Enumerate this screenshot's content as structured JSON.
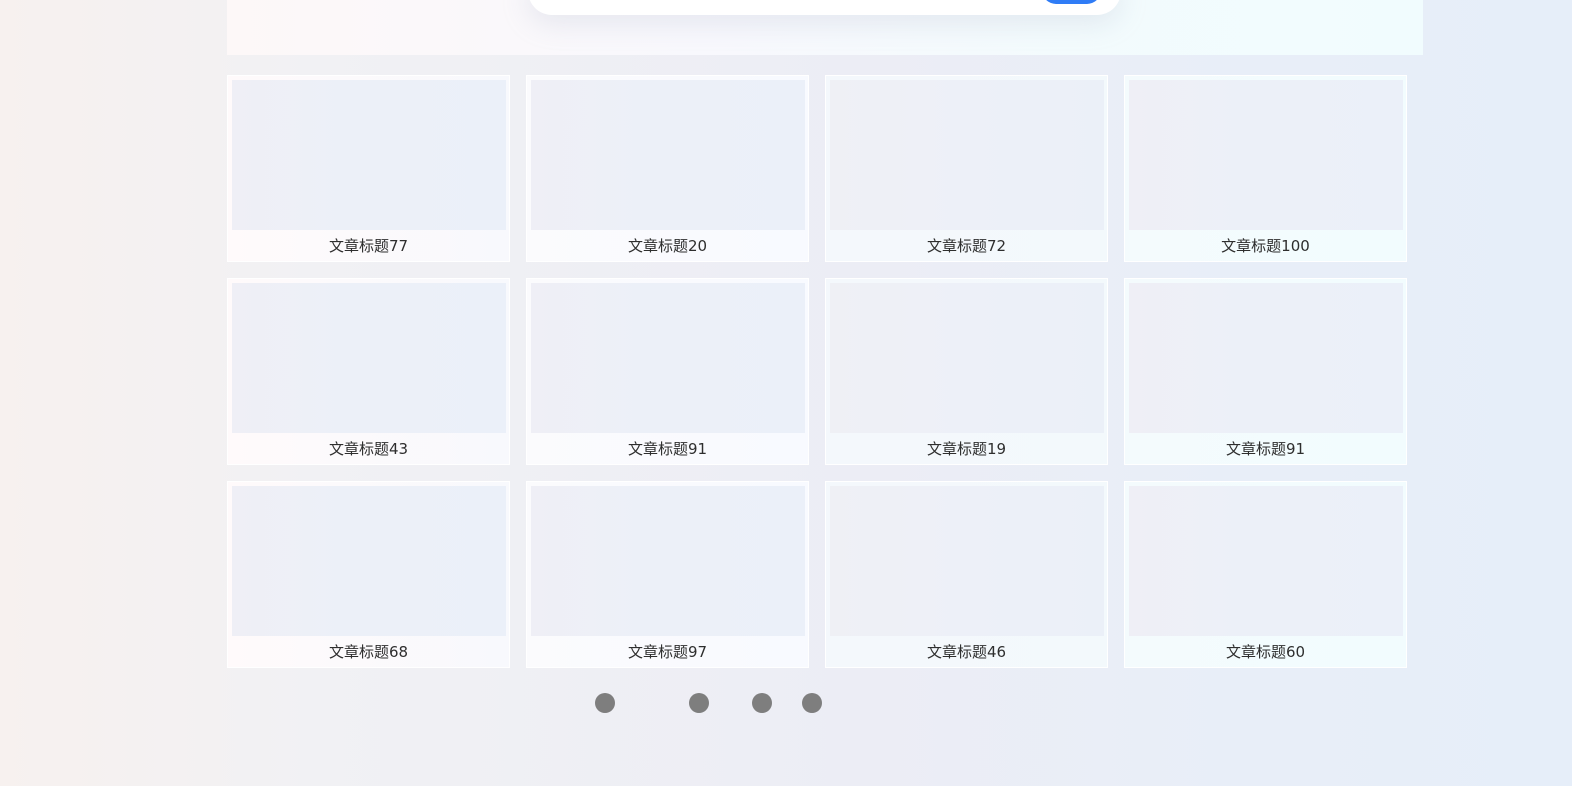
{
  "search": {
    "input_value": "",
    "button_label": ""
  },
  "articles": {
    "cards": [
      {
        "title": "文章标题77"
      },
      {
        "title": "文章标题20"
      },
      {
        "title": "文章标题72"
      },
      {
        "title": "文章标题100"
      },
      {
        "title": "文章标题43"
      },
      {
        "title": "文章标题91"
      },
      {
        "title": "文章标题19"
      },
      {
        "title": "文章标题91"
      },
      {
        "title": "文章标题68"
      },
      {
        "title": "文章标题97"
      },
      {
        "title": "文章标题46"
      },
      {
        "title": "文章标题60"
      }
    ]
  },
  "pagination": {
    "pages": [
      {
        "label": ""
      },
      {
        "label": ""
      },
      {
        "label": ""
      },
      {
        "label": ""
      }
    ]
  },
  "colors": {
    "accent": "#2f7cf6",
    "dot": "#7e7e7e",
    "text": "#2e2e2e"
  }
}
